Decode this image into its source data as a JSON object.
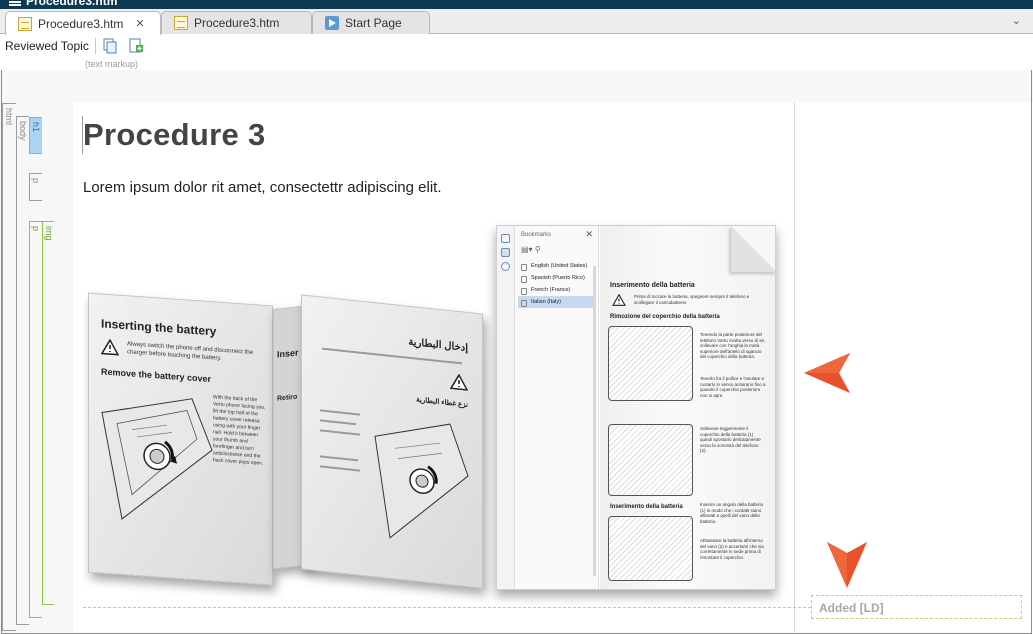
{
  "window": {
    "title": "Procedure3.htm"
  },
  "tabs": [
    {
      "label": "Procedure3.htm",
      "icon": "htm-document-icon",
      "active": true,
      "close": "✕"
    },
    {
      "label": "Procedure3.htm",
      "icon": "htm-document-icon",
      "active": false
    },
    {
      "label": "Start Page",
      "icon": "start-page-icon",
      "active": false
    }
  ],
  "tab_overflow": "⌄",
  "toolbar": {
    "label": "Reviewed Topic",
    "buttons": [
      "copy-topic-icon",
      "insert-topic-icon"
    ]
  },
  "markup_hint": "(text markup)",
  "structure_bar": {
    "html": "html",
    "body": "body",
    "h1": "h1",
    "p1": "p",
    "p2": "p",
    "img": "img"
  },
  "content": {
    "heading": "Procedure 3",
    "paragraph": "Lorem ipsum dolor rit amet, consectettr adipiscing elit."
  },
  "figure": {
    "panel1_title": "Inserting the battery",
    "panel1_note": "Always switch the phone off and disconnect the charger before touching the battery.",
    "panel1_subtitle": "Remove the battery cover",
    "panel1_body": "With the back of the Vertu phone facing you, lift the top half of the battery cover release using with your finger nail. Hold it between your thumb and forefinger and turn anticlockwise and the back cover pops open.",
    "panel2_title_stub": "Inser",
    "panel2_sub_stub": "Retiro",
    "panel3_title": "إدخال البطارية",
    "panel3_subtitle": "نزع غطاء البطارية",
    "bookmarks_header": "Bookmarks",
    "bookmarks_close": "✕",
    "bookmarks": [
      "English (United States)",
      "Spanish (Puerto Rico)",
      "French (France)",
      "Italian (Italy)"
    ],
    "bookmark_selected": 3,
    "page_title_1": "Inserimento della batteria",
    "page_note_1": "Prima di toccare la batteria, spegnere sempre il telefono e scollegare il caricabatterie.",
    "page_title_2": "Rimozione del coperchio della batteria",
    "page_text_2": "Tenendo la parte posteriore del telefono Vertu rivolta verso di sé, sollevare con l'unghia la metà superiore dell'anello di sgancio del coperchio della batteria.",
    "page_text_3": "Tenerlo fra il pollice e l'anulare e ruotarlo in senso antiorario fino a quando il coperchio posteriore non si apre.",
    "page_text_4": "Sollevare leggermente il coperchio della batteria (1) quindi spostarlo delicatamente verso la sommità del telefono (2).",
    "page_title_3": "Inserimento della batteria",
    "page_text_5": "Inserire un angolo della batteria (1) in modo che i contatti siano allineati a quelli del vano della batteria.",
    "page_text_6": "Abbassare la batteria all'interno del vano (2) e accertarsi che sia correttamente in sede prima di rimontare il coperchio."
  },
  "change_marker": {
    "label": "Added [LD]",
    "color": "#e8512a"
  }
}
